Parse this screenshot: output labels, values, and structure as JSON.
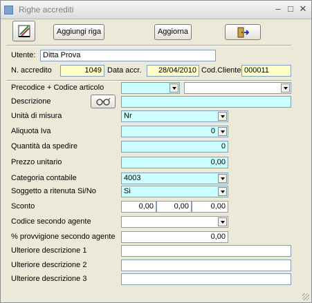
{
  "window": {
    "title": "Righe accrediti"
  },
  "toolbar": {
    "add_label": "Aggiungi riga",
    "update_label": "Aggiorna"
  },
  "header": {
    "utente_label": "Utente:",
    "utente_value": "Ditta Prova",
    "naccr_label": "N. accredito",
    "naccr_value": "1049",
    "data_label": "Data accr.",
    "data_value": "28/04/2010",
    "cod_label": "Cod.Cliente",
    "cod_value": "000011"
  },
  "form": {
    "precodice_label": "Precodice + Codice articolo",
    "precodice_value": "",
    "descrizione_label": "Descrizione",
    "descrizione_value": "",
    "unita_label": "Unità di misura",
    "unita_value": "Nr",
    "iva_label": "Aliquota Iva",
    "iva_value": "0",
    "quantita_label": "Quantità da spedire",
    "quantita_value": "0",
    "prezzo_label": "Prezzo unitario",
    "prezzo_value": "0,00",
    "categoria_label": "Categoria contabile",
    "categoria_value": "4003",
    "ritenuta_label": "Soggetto a ritenuta  Si/No",
    "ritenuta_value": "Si",
    "sconto_label": "Sconto",
    "sconto_values": [
      "0,00",
      "0,00",
      "0,00"
    ],
    "agente_label": "Codice secondo agente",
    "agente_value": "",
    "provvigione_label": "% provvigione secondo agente",
    "provvigione_value": "0,00",
    "desc1_label": "Ulteriore descrizione 1",
    "desc1_value": "",
    "desc2_label": "Ulteriore descrizione 2",
    "desc2_value": "",
    "desc3_label": "Ulteriore descrizione 3",
    "desc3_value": ""
  },
  "colors": {
    "required": "#ccffff",
    "readonly": "#ffffc6",
    "surface": "#ece9d8"
  }
}
